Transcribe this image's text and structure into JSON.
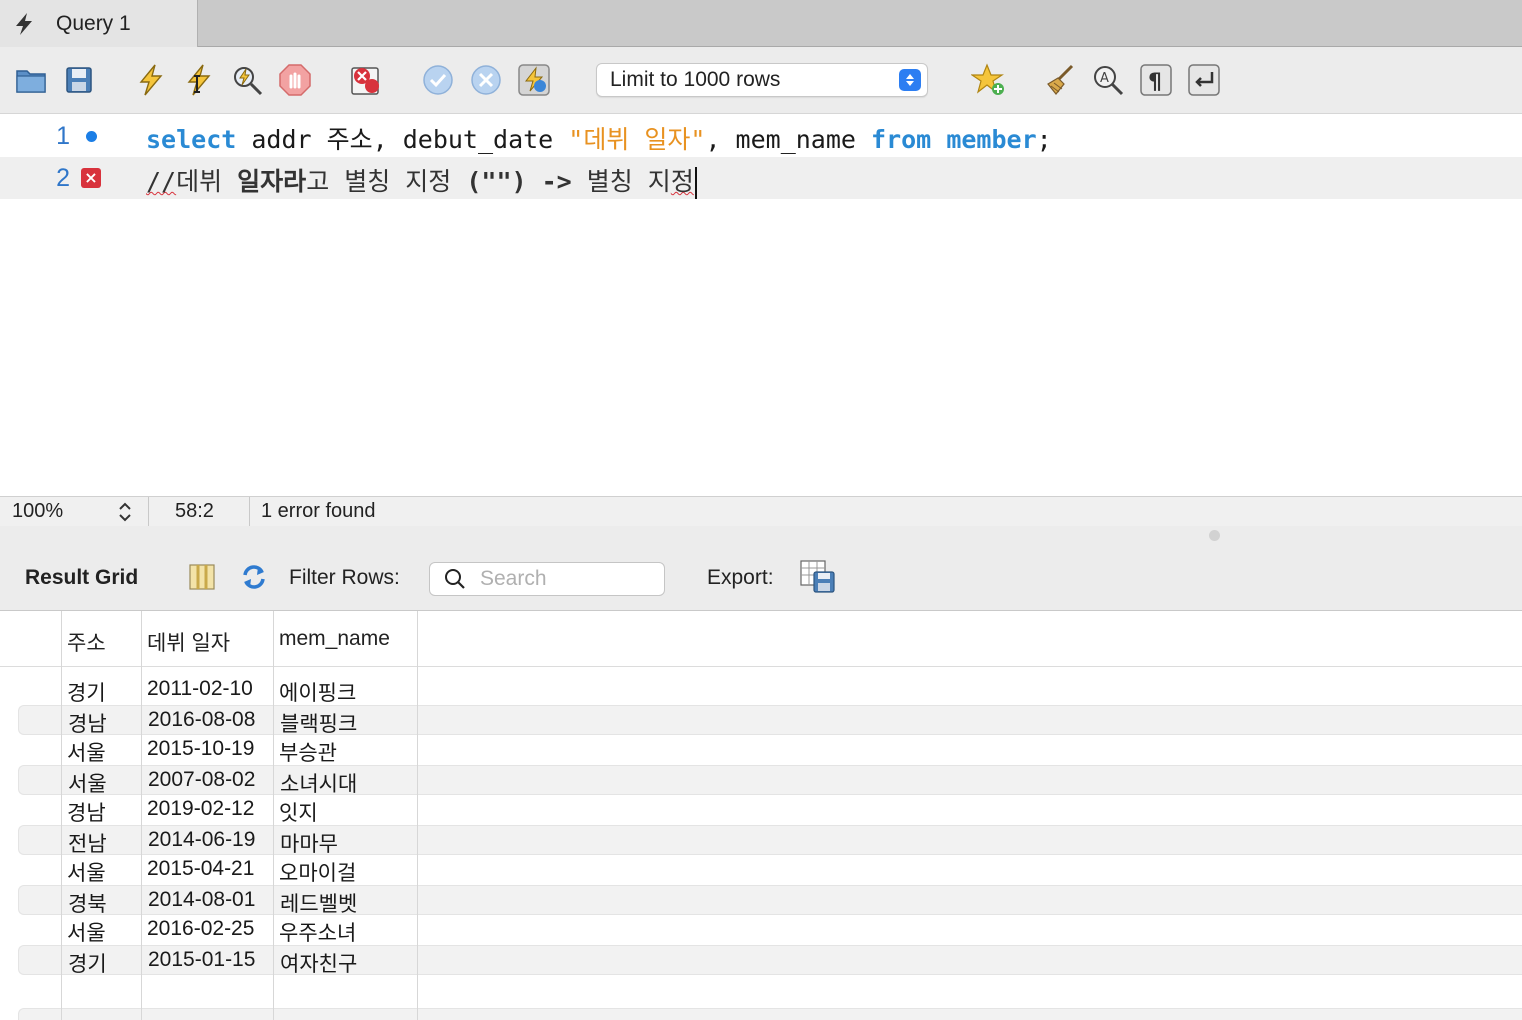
{
  "tab": {
    "title": "Query 1",
    "icon": "lightning-icon"
  },
  "toolbar": {
    "limit_select": "Limit to 1000 rows"
  },
  "editor": {
    "lines": [
      {
        "number": "1"
      },
      {
        "number": "2"
      }
    ]
  },
  "status": {
    "zoom": "100%",
    "position": "58:2",
    "message": "1 error found"
  },
  "results": {
    "label": "Result Grid",
    "filter_label": "Filter Rows:",
    "search_placeholder": "Search",
    "export_label": "Export:",
    "columns": [
      "주소",
      "데뷔 일자",
      "mem_name"
    ],
    "rows": [
      [
        "경기",
        "2011-02-10",
        "에이핑크"
      ],
      [
        "경남",
        "2016-08-08",
        "블랙핑크"
      ],
      [
        "서울",
        "2015-10-19",
        "부승관"
      ],
      [
        "서울",
        "2007-08-02",
        "소녀시대"
      ],
      [
        "경남",
        "2019-02-12",
        "잇지"
      ],
      [
        "전남",
        "2014-06-19",
        "마마무"
      ],
      [
        "서울",
        "2015-04-21",
        "오마이걸"
      ],
      [
        "경북",
        "2014-08-01",
        "레드벨벳"
      ],
      [
        "서울",
        "2016-02-25",
        "우주소녀"
      ],
      [
        "경기",
        "2015-01-15",
        "여자친구"
      ]
    ]
  },
  "code": {
    "l1_kw_select": "select",
    "l1_t1": " addr 주소, debut_date ",
    "l1_str": "\"데뷔 일자\"",
    "l1_t2": ", mem_name ",
    "l1_kw_from": "from",
    "l1_sp": " ",
    "l1_kw_member": "member",
    "l1_semi": ";",
    "l2_slashes": "//",
    "l2_t1": "데뷔 ",
    "l2_bold": "일자라",
    "l2_t2": "고 별칭 지정 ",
    "l2_paren": "(\"\") ->",
    "l2_t3": " 별칭 지",
    "l2_last": "정"
  },
  "colors": {
    "keyword": "#2a8ad4",
    "string": "#e89221",
    "line_number": "#2f76c9",
    "error": "#d8323c",
    "accent": "#2c7ef2"
  }
}
